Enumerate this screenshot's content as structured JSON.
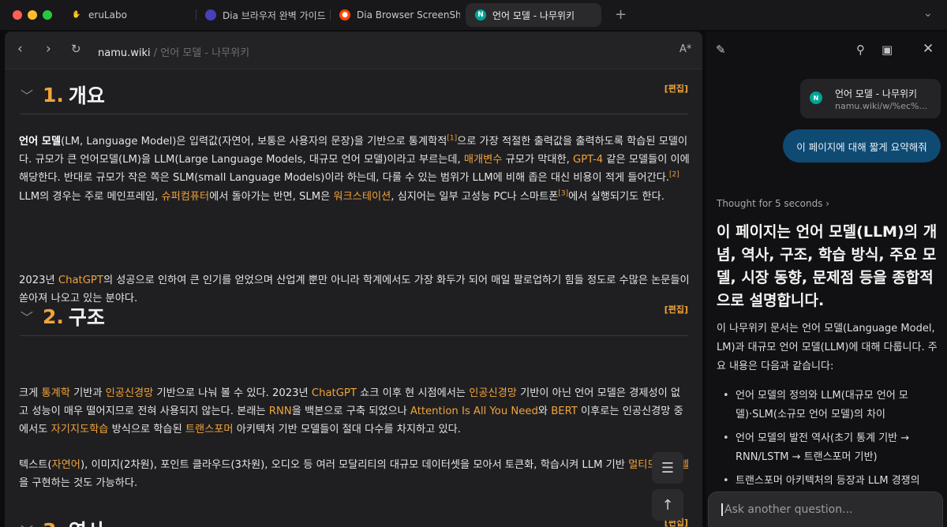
{
  "tabs": [
    {
      "label": "eruLabo",
      "icon": "hand-icon"
    },
    {
      "label": "Dia 브라우저 완벽 가이드:",
      "icon": "dia-icon"
    },
    {
      "label": "Dia Browser ScreenSho",
      "icon": "reddit-icon"
    },
    {
      "label": "언어 모델 - 나무위키",
      "icon": "namuwiki-icon",
      "active": true
    }
  ],
  "url": {
    "host": "namu.wiki",
    "rest": " / 언어 모델 - 나무위키"
  },
  "reader_label": "A*",
  "article": {
    "edit_label": "[편집]",
    "s1": {
      "num": "1.",
      "title": "개요",
      "p1": {
        "t1": "언어 모델",
        "t2": "(LM, Language Model)은 입력값(자연어, 보통은 사용자의 문장)을 기반으로 통계학적",
        "sup1": "[1]",
        "t3": "으로 가장 적절한 출력값을 출력하도록 학습된 모델이다. 규모가 큰 언어모델(LM)을 LLM(Large Language Models, 대규모 언어 모델)이라고 부르는데, ",
        "l1": "매개변수",
        "t4": " 규모가 막대한, ",
        "l2": "GPT-4",
        "t5": " 같은 모델들이 이에 해당한다. 반대로 규모가 작은 쪽은 SLM(small Language Models)이라 하는데, 다룰 수 있는 범위가 LLM에 비해 좁은 대신 비용이 적게 들어간다.",
        "sup2": "[2]",
        "t6": " LLM의 경우는 주로 메인프레임, ",
        "l3": "슈퍼컴퓨터",
        "t7": "에서 돌아가는 반면, SLM은 ",
        "l4": "워크스테이션",
        "t8": ", 심지어는 일부 고성능 PC나 스마트폰",
        "sup3": "[3]",
        "t9": "에서 실행되기도 한다."
      },
      "p2": {
        "t1": "2023년 ",
        "l1": "ChatGPT",
        "t2": "의 성공으로 인하여 큰 인기를 얻었으며 산업계 뿐만 아니라 학계에서도 가장 화두가 되어 매일 팔로업하기 힘들 정도로 수많은 논문들이 쏟아져 나오고 있는 분야다."
      }
    },
    "s2": {
      "num": "2.",
      "title": "구조",
      "p1": {
        "t1": "크게 ",
        "l1": "통계학",
        "t2": " 기반과 ",
        "l2": "인공신경망",
        "t3": " 기반으로 나눠 볼 수 있다. 2023년 ",
        "l3": "ChatGPT",
        "t4": " 쇼크 이후 현 시점에서는 ",
        "l4": "인공신경망",
        "t5": " 기반이 아닌 언어 모델은 경제성이 없고 성능이 매우 떨어지므로 전혀 사용되지 않는다. 본래는 ",
        "l5": "RNN",
        "t6": "을 백본으로 구축 되었으나 ",
        "l6": "Attention Is All You Need",
        "t7": "와 ",
        "l7": "BERT",
        "t8": " 이후로는 인공신경망 중에서도 ",
        "l8": "자기지도학습",
        "t9": " 방식으로 학습된 ",
        "l9": "트랜스포머",
        "t10": " 아키텍처 기반 모델들이 절대 다수를 차지하고 있다."
      },
      "p2": {
        "t1": "텍스트(",
        "l1": "자연어",
        "t2": "), 이미지(2차원), 포인트 클라우드(3차원), 오디오 등 여러 모달리티의 대규모 데이터셋을 모아서 토큰화, 학습시켜 LLM 기반 ",
        "l2": "멀티모달 모델",
        "t3": "을 구현하는 것도 가능하다."
      }
    },
    "s3": {
      "num": "3.",
      "title": "역사"
    }
  },
  "assistant": {
    "source": {
      "title": "언어 모델 - 나무위키",
      "url": "namu.wiki/w/%ec%..."
    },
    "user_message": "이 페이지에 대해 짧게 요약해줘",
    "thought": "Thought for 5 seconds",
    "answer_head": "이 페이지는 언어 모델(LLM)의 개념, 역사, 구조, 학습 방식, 주요 모델, 시장 동향, 문제점 등을 종합적으로 설명합니다.",
    "answer_body": "이 나무위키 문서는 언어 모델(Language Model, LM)과 대규모 언어 모델(LLM)에 대해 다룹니다. 주요 내용은 다음과 같습니다:",
    "bullets": [
      "언어 모델의 정의와 LLM(대규모 언어 모델)·SLM(소규모 언어 모델)의 차이",
      "언어 모델의 발전 역사(초기 통계 기반 → RNN/LSTM → 트랜스포머 기반)",
      "트랜스포머 아키텍처의 등장과 LLM 경쟁의"
    ],
    "ask_placeholder": "Ask another question..."
  },
  "colors": {
    "accent": "#f2a33a",
    "user_bubble": "#0f4a73",
    "favicon": "#00a495"
  }
}
